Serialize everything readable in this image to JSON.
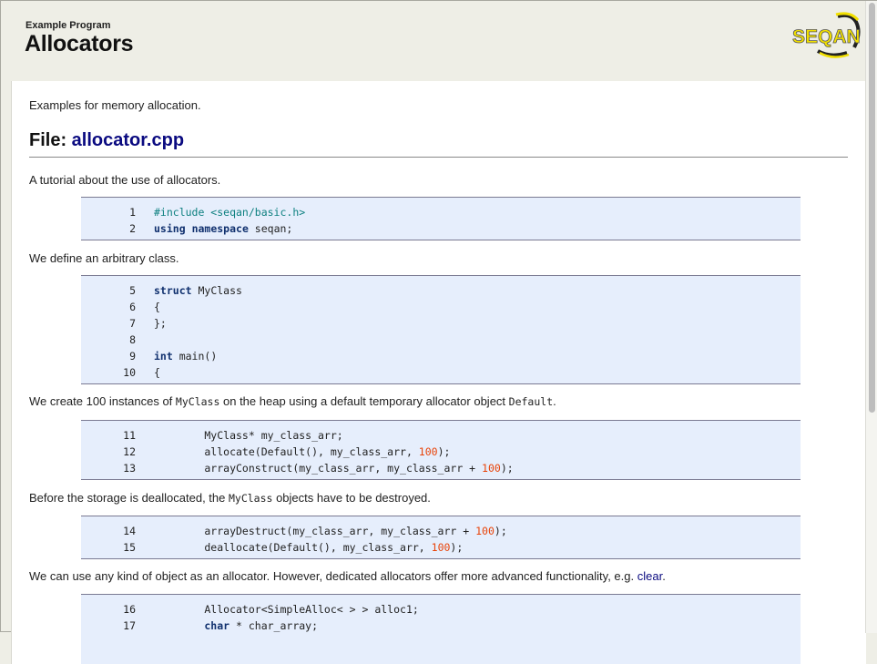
{
  "header": {
    "kicker": "Example Program",
    "title": "Allocators",
    "logo_text": "SEQAN"
  },
  "content": {
    "intro": "Examples for memory allocation.",
    "file_heading": {
      "label": "File: ",
      "link": "allocator.cpp"
    },
    "tutorial_text": "A tutorial about the use of allocators.",
    "block1": {
      "line_numbers": [
        "1",
        "2"
      ],
      "lines": [
        [
          {
            "text": "#include <seqan/basic.h>",
            "style": "pp"
          }
        ],
        [
          {
            "text": "using",
            "style": "kw"
          },
          {
            "text": " "
          },
          {
            "text": "namespace",
            "style": "kw"
          },
          {
            "text": " seqan;"
          }
        ]
      ]
    },
    "para2": "We define an arbitrary class.",
    "block2": {
      "line_numbers": [
        "5",
        "6",
        "7",
        "8",
        "9",
        "10"
      ],
      "lines": [
        [
          {
            "text": "struct",
            "style": "kw"
          },
          {
            "text": " MyClass"
          }
        ],
        [
          {
            "text": "{"
          }
        ],
        [
          {
            "text": "};"
          }
        ],
        [],
        [
          {
            "text": "int",
            "style": "kw"
          },
          {
            "text": " main()"
          }
        ],
        [
          {
            "text": "{"
          }
        ]
      ]
    },
    "para3": {
      "t1": "We create 100 instances of ",
      "c1": "MyClass",
      "t2": " on the heap using a default temporary allocator object ",
      "c2": "Default",
      "t3": "."
    },
    "block3": {
      "line_numbers": [
        "11",
        "12",
        "13"
      ],
      "lines": [
        [
          {
            "text": "        MyClass* my_class_arr;"
          }
        ],
        [
          {
            "text": "        allocate(Default(), my_class_arr, "
          },
          {
            "text": "100",
            "style": "num"
          },
          {
            "text": ");"
          }
        ],
        [
          {
            "text": "        arrayConstruct(my_class_arr, my_class_arr + "
          },
          {
            "text": "100",
            "style": "num"
          },
          {
            "text": ");"
          }
        ]
      ]
    },
    "para4": {
      "t1": "Before the storage is deallocated, the ",
      "c1": "MyClass",
      "t2": " objects have to be destroyed."
    },
    "block4": {
      "line_numbers": [
        "14",
        "15"
      ],
      "lines": [
        [
          {
            "text": "        arrayDestruct(my_class_arr, my_class_arr + "
          },
          {
            "text": "100",
            "style": "num"
          },
          {
            "text": ");"
          }
        ],
        [
          {
            "text": "        deallocate(Default(), my_class_arr, "
          },
          {
            "text": "100",
            "style": "num"
          },
          {
            "text": ");"
          }
        ]
      ]
    },
    "para5": {
      "t1": "We can use any kind of object as an allocator. However, dedicated allocators offer more advanced functionality, e.g. ",
      "link": "clear",
      "t2": "."
    },
    "block5": {
      "line_numbers": [
        "16",
        "17"
      ],
      "lines": [
        [
          {
            "text": "        Allocator<SimpleAlloc< > > alloc1;"
          }
        ],
        [
          {
            "text": "char",
            "style": "kw",
            "indent": "        "
          },
          {
            "text": " * char_array;"
          }
        ]
      ]
    }
  },
  "colors": {
    "header_bg": "#eeeee6",
    "link": "#0a0a80",
    "code_bg": "#e6eefc",
    "keyword": "#10306e",
    "preprocessor": "#0e8080",
    "number": "#e8440a"
  }
}
